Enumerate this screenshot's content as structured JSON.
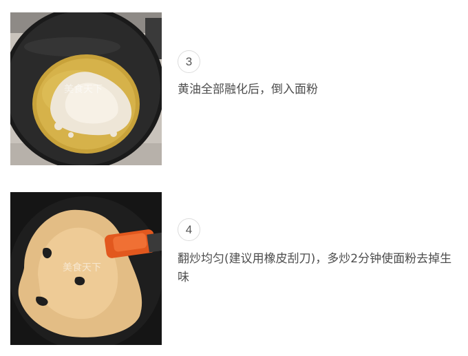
{
  "steps": [
    {
      "number": "3",
      "text": "黄油全部融化后，倒入面粉",
      "watermark": "美食天下"
    },
    {
      "number": "4",
      "text": "翻炒均匀(建议用橡皮刮刀)，多炒2分钟使面粉去掉生味",
      "watermark": "美食天下"
    }
  ]
}
